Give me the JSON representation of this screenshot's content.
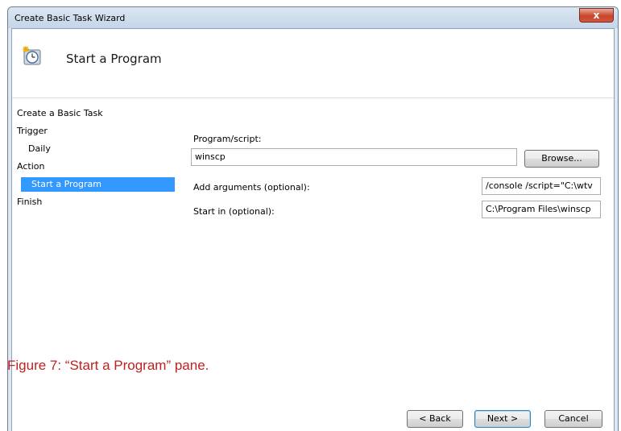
{
  "window": {
    "title": "Create Basic Task Wizard",
    "close_label": "x"
  },
  "header": {
    "title": "Start a Program",
    "icon": "task-scheduler-clock-icon"
  },
  "steps": [
    {
      "label": "Create a Basic Task"
    },
    {
      "label": "Trigger"
    },
    {
      "label": "Daily"
    },
    {
      "label": "Action"
    },
    {
      "label": "Start a Program"
    },
    {
      "label": "Finish"
    }
  ],
  "form": {
    "program_label": "Program/script:",
    "program_value": "winscp",
    "browse_label": "Browse...",
    "arguments_label": "Add arguments (optional):",
    "arguments_value": "/console /script=\"C:\\wtv",
    "start_in_label": "Start in (optional):",
    "start_in_value": "C:\\Program Files\\winscp"
  },
  "buttons": {
    "back": "< Back",
    "next": "Next >",
    "cancel": "Cancel"
  },
  "caption": "Figure 7:  “Start a Program” pane."
}
